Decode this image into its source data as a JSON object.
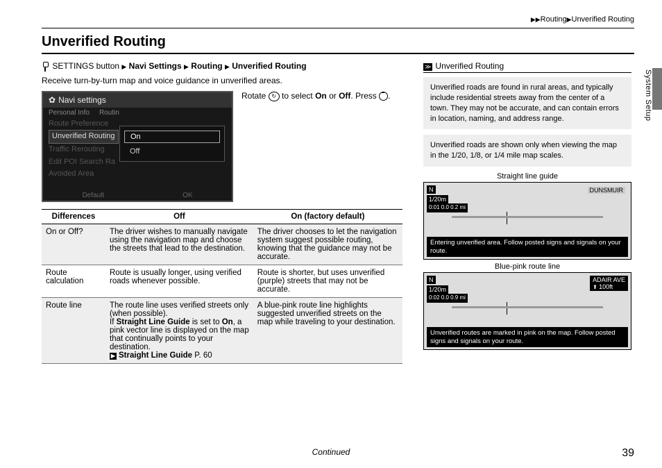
{
  "breadcrumb_top": {
    "a": "Routing",
    "b": "Unverified Routing"
  },
  "section_title": "Unverified Routing",
  "path": {
    "btn": "SETTINGS button",
    "s1": "Navi Settings",
    "s2": "Routing",
    "s3": "Unverified Routing"
  },
  "intro": "Receive turn-by-turn map and voice guidance in unverified areas.",
  "rotate": {
    "pre": "Rotate ",
    "mid": " to select ",
    "on": "On",
    "or": " or ",
    "off": "Off",
    "post": ". Press ",
    "end": "."
  },
  "device": {
    "title": "Navi settings",
    "tab1": "Personal Info",
    "tab2": "Routin",
    "m1": "Route Preference",
    "m2": "Unverified Routing",
    "m3": "Traffic Rerouting",
    "m4": "Edit POI Search Ra",
    "m5": "Avoided Area",
    "opt_on": "On",
    "opt_off": "Off",
    "foot1": "Default",
    "foot2": "OK"
  },
  "table": {
    "h1": "Differences",
    "h2": "Off",
    "h3": "On (factory default)",
    "r1c1": "On or Off?",
    "r1c2": "The driver wishes to manually navigate using the navigation map and choose the streets that lead to the destination.",
    "r1c3": "The driver chooses to let the navigation system suggest possible routing, knowing that the guidance may not be accurate.",
    "r2c1": "Route calculation",
    "r2c2": "Route is usually longer, using verified roads whenever possible.",
    "r2c3": "Route is shorter, but uses unverified (purple) streets that may not be accurate.",
    "r3c1": "Route line",
    "r3c2a": "The route line uses verified streets only (when possible).",
    "r3c2b_pre": "If ",
    "r3c2b_bold": "Straight Line Guide",
    "r3c2b_mid": " is set to ",
    "r3c2b_on": "On",
    "r3c2b_post": ", a pink vector line is displayed on the map that continually points to your destination.",
    "r3c2_link": "Straight Line Guide",
    "r3c2_page": " P. 60",
    "r3c3": "A blue-pink route line highlights suggested unverified streets on the map while traveling to your destination."
  },
  "right": {
    "head": "Unverified Routing",
    "p1": "Unverified roads are found in rural areas, and typically include residential streets away from the center of a town. They may not be accurate, and can contain errors in location, naming, and address range.",
    "p2": "Unverified roads are shown only when viewing the map in the 1/20, 1/8, or 1/4 mile map scales.",
    "cap1": "Straight line guide",
    "cap2": "Blue-pink route line"
  },
  "map1": {
    "scale": "1/20m",
    "label_r": "DUNSMUIR",
    "stats": "0:01\n0.0\n0.2\nmi",
    "msg": "Entering unverified area.\nFollow posted signs and signals on your route."
  },
  "map2": {
    "scale": "1/20m",
    "label_r": "ADAIR AVE",
    "dist": "100ft",
    "stats": "0:02\n0.0\n0.9\nmi",
    "msg": "Unverified routes are marked in pink on the map. Follow posted signs and signals on your route."
  },
  "side_tab": "System Setup",
  "continued": "Continued",
  "page_num": "39"
}
